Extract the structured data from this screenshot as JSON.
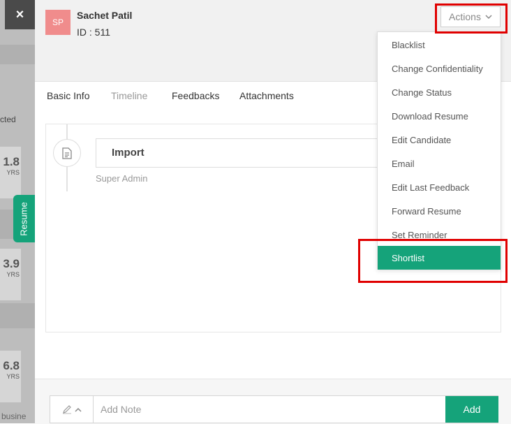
{
  "background": {
    "close_label": "×",
    "filter_fragment": "cted",
    "stats": [
      {
        "value": "1.8",
        "unit": "YRS"
      },
      {
        "value": "3.9",
        "unit": "YRS"
      },
      {
        "value": "6.8",
        "unit": "YRS"
      }
    ],
    "footer_fragment": "busine"
  },
  "resume_tab": {
    "label": "Resume"
  },
  "candidate": {
    "initials": "SP",
    "name": "Sachet Patil",
    "id_label": "ID : 511"
  },
  "actions": {
    "label": "Actions",
    "menu": [
      {
        "label": "Blacklist"
      },
      {
        "label": "Change Confidentiality"
      },
      {
        "label": "Change Status"
      },
      {
        "label": "Download Resume"
      },
      {
        "label": "Edit Candidate"
      },
      {
        "label": "Email"
      },
      {
        "label": "Edit Last Feedback"
      },
      {
        "label": "Forward Resume"
      },
      {
        "label": "Set Reminder"
      },
      {
        "label": "Shortlist"
      }
    ]
  },
  "tabs": [
    {
      "label": "Basic Info"
    },
    {
      "label": "Timeline"
    },
    {
      "label": "Feedbacks"
    },
    {
      "label": "Attachments"
    }
  ],
  "timeline": {
    "event_title": "Import",
    "event_author": "Super Admin"
  },
  "note": {
    "placeholder": "Add Note",
    "add_label": "Add"
  },
  "colors": {
    "accent": "#15a37a",
    "highlight": "#e00000",
    "avatar": "#f08c8c"
  }
}
